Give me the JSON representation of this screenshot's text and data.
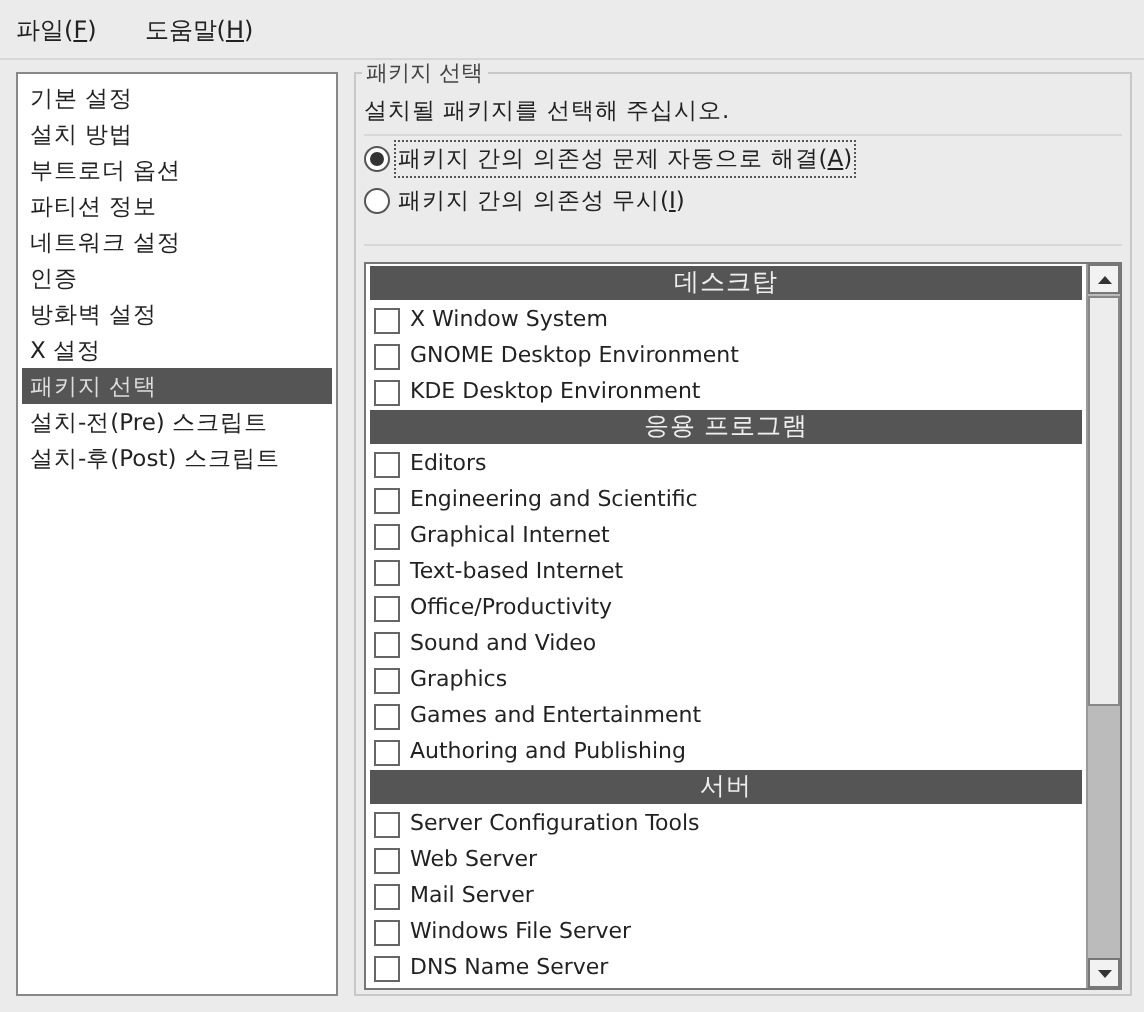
{
  "menu": [
    {
      "label": "파일(",
      "key": "F",
      "after": ")"
    },
    {
      "label": "도움말(",
      "key": "H",
      "after": ")"
    }
  ],
  "sidebar": {
    "items": [
      {
        "label": "기본 설정",
        "selected": false
      },
      {
        "label": "설치 방법",
        "selected": false
      },
      {
        "label": "부트로더 옵션",
        "selected": false
      },
      {
        "label": "파티션 정보",
        "selected": false
      },
      {
        "label": "네트워크 설정",
        "selected": false
      },
      {
        "label": "인증",
        "selected": false
      },
      {
        "label": "방화벽 설정",
        "selected": false
      },
      {
        "label": "X 설정",
        "selected": false
      },
      {
        "label": "패키지 선택",
        "selected": true
      },
      {
        "label": "설치-전(Pre) 스크립트",
        "selected": false
      },
      {
        "label": "설치-후(Post) 스크립트",
        "selected": false
      }
    ]
  },
  "group": {
    "title": "패키지 선택",
    "description": "설치될 패키지를 선택해 주십시오.",
    "options": [
      {
        "label": "패키지 간의 의존성 문제 자동으로 해결(",
        "key": "A",
        "after": ")",
        "selected": true
      },
      {
        "label": "패키지 간의 의존성 무시(",
        "key": "I",
        "after": ")",
        "selected": false
      }
    ],
    "packages": [
      {
        "kind": "header",
        "label": "데스크탑"
      },
      {
        "kind": "item",
        "label": "X Window System",
        "checked": false
      },
      {
        "kind": "item",
        "label": "GNOME Desktop Environment",
        "checked": false
      },
      {
        "kind": "item",
        "label": "KDE Desktop Environment",
        "checked": false
      },
      {
        "kind": "header",
        "label": "응용 프로그램"
      },
      {
        "kind": "item",
        "label": "Editors",
        "checked": false
      },
      {
        "kind": "item",
        "label": "Engineering and Scientific",
        "checked": false
      },
      {
        "kind": "item",
        "label": "Graphical Internet",
        "checked": false
      },
      {
        "kind": "item",
        "label": "Text-based Internet",
        "checked": false
      },
      {
        "kind": "item",
        "label": "Office/Productivity",
        "checked": false
      },
      {
        "kind": "item",
        "label": "Sound and Video",
        "checked": false
      },
      {
        "kind": "item",
        "label": "Graphics",
        "checked": false
      },
      {
        "kind": "item",
        "label": "Games and Entertainment",
        "checked": false
      },
      {
        "kind": "item",
        "label": "Authoring and Publishing",
        "checked": false
      },
      {
        "kind": "header",
        "label": "서버"
      },
      {
        "kind": "item",
        "label": "Server Configuration Tools",
        "checked": false
      },
      {
        "kind": "item",
        "label": "Web Server",
        "checked": false
      },
      {
        "kind": "item",
        "label": "Mail Server",
        "checked": false
      },
      {
        "kind": "item",
        "label": "Windows File Server",
        "checked": false
      },
      {
        "kind": "item",
        "label": "DNS Name Server",
        "checked": false
      }
    ]
  }
}
